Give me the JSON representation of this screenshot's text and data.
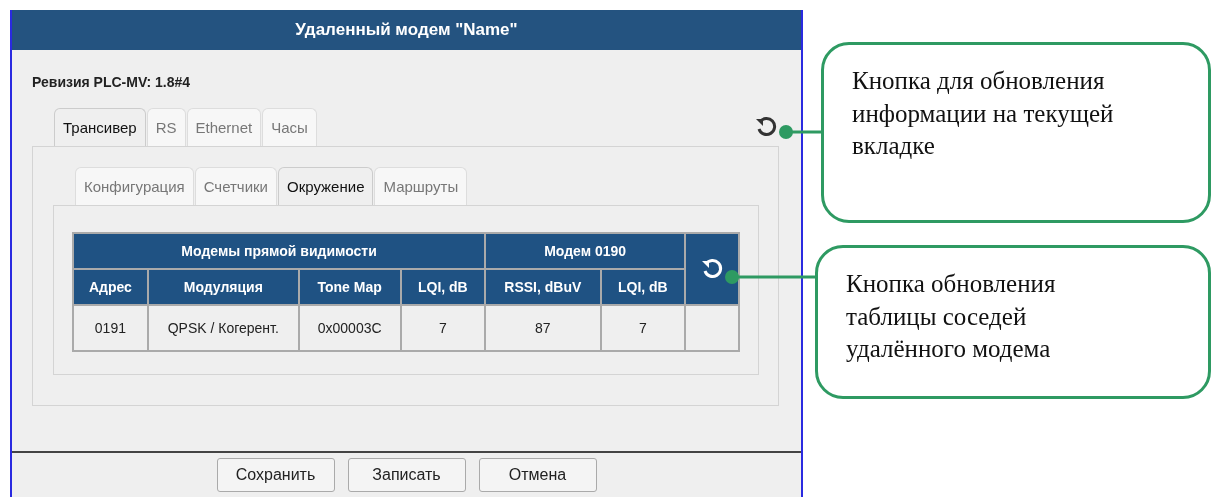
{
  "dialog": {
    "title": "Удаленный модем \"Name\"",
    "revision": "Ревизия PLC-MV: 1.8#4",
    "tabs": [
      {
        "label": "Трансивер",
        "selected": true
      },
      {
        "label": "RS",
        "selected": false
      },
      {
        "label": "Ethernet",
        "selected": false
      },
      {
        "label": "Часы",
        "selected": false
      }
    ],
    "subtabs": [
      {
        "label": "Конфигурация",
        "selected": false
      },
      {
        "label": "Счетчики",
        "selected": false
      },
      {
        "label": "Окружение",
        "selected": true
      },
      {
        "label": "Маршруты",
        "selected": false
      }
    ],
    "table": {
      "group_headers": [
        {
          "label": "Модемы прямой видимости"
        },
        {
          "label": "Модем 0190"
        }
      ],
      "columns": [
        "Адрес",
        "Модуляция",
        "Tone Map",
        "LQI, dB",
        "RSSI, dBuV",
        "LQI, dB"
      ],
      "rows": [
        [
          "0191",
          "QPSK / Когерент.",
          "0x00003C",
          "7",
          "87",
          "7"
        ]
      ]
    },
    "buttons": [
      "Сохранить",
      "Записать",
      "Отмена"
    ]
  },
  "callouts": [
    {
      "text": "Кнопка для обновления информации на текущей вкладке"
    },
    {
      "text": "Кнопка обновления таблицы соседей удалённого модема"
    }
  ]
}
